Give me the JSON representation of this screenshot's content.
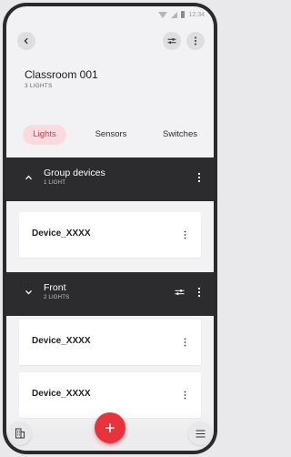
{
  "status_bar": {
    "time": "12:34"
  },
  "header": {
    "title": "Classroom 001",
    "subtitle": "3 LIGHTS"
  },
  "tabs": [
    {
      "label": "Lights",
      "active": true
    },
    {
      "label": "Sensors",
      "active": false
    },
    {
      "label": "Switches",
      "active": false
    }
  ],
  "groups": [
    {
      "title": "Group devices",
      "subtitle": "1 LIGHT",
      "expanded": true,
      "devices": [
        {
          "name": "Device_XXXX"
        }
      ]
    },
    {
      "title": "Front",
      "subtitle": "2 LIGHTS",
      "expanded": false,
      "devices": [
        {
          "name": "Device_XXXX"
        },
        {
          "name": "Device_XXXX"
        }
      ]
    }
  ],
  "icons": {
    "back": "chevron-left-icon",
    "filter": "sliders-icon",
    "more": "more-vertical-icon",
    "building": "building-icon",
    "add": "plus-icon",
    "menu": "menu-icon"
  },
  "colors": {
    "accent": "#e8323c",
    "active_tab_bg": "#fbdbdf",
    "group_bar": "#2c2c2e"
  }
}
